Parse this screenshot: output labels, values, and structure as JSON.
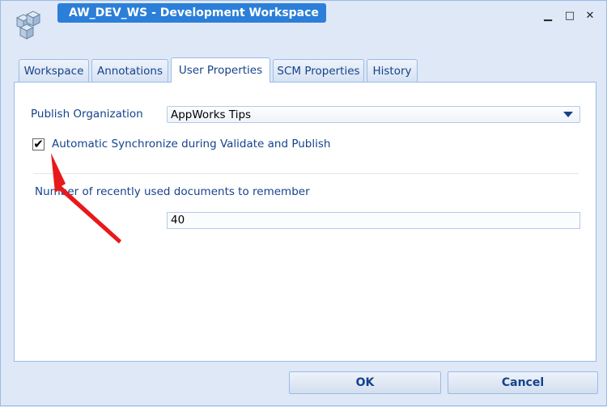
{
  "window": {
    "title": "AW_DEV_WS - Development Workspace",
    "minimize_glyph": "▁",
    "maximize_glyph": "□",
    "close_glyph": "✕"
  },
  "tabs": [
    {
      "label": "Workspace"
    },
    {
      "label": "Annotations"
    },
    {
      "label": "User Properties"
    },
    {
      "label": "SCM Properties"
    },
    {
      "label": "History"
    }
  ],
  "active_tab": "User Properties",
  "form": {
    "publish_org_label": "Publish Organization",
    "publish_org_value": "AppWorks Tips",
    "auto_sync_label": "Automatic Synchronize during Validate and Publish",
    "auto_sync_checked": true,
    "recent_docs_label": "Number of recently used documents to remember",
    "recent_docs_value": "40"
  },
  "buttons": {
    "ok": "OK",
    "cancel": "Cancel"
  },
  "colors": {
    "accent": "#2b7fd8",
    "text": "#15428b",
    "annotation_arrow": "#e8191b"
  },
  "icons": [
    "app-cubes-icon",
    "dropdown-arrow-icon",
    "checkmark-icon",
    "annotation-arrow"
  ]
}
